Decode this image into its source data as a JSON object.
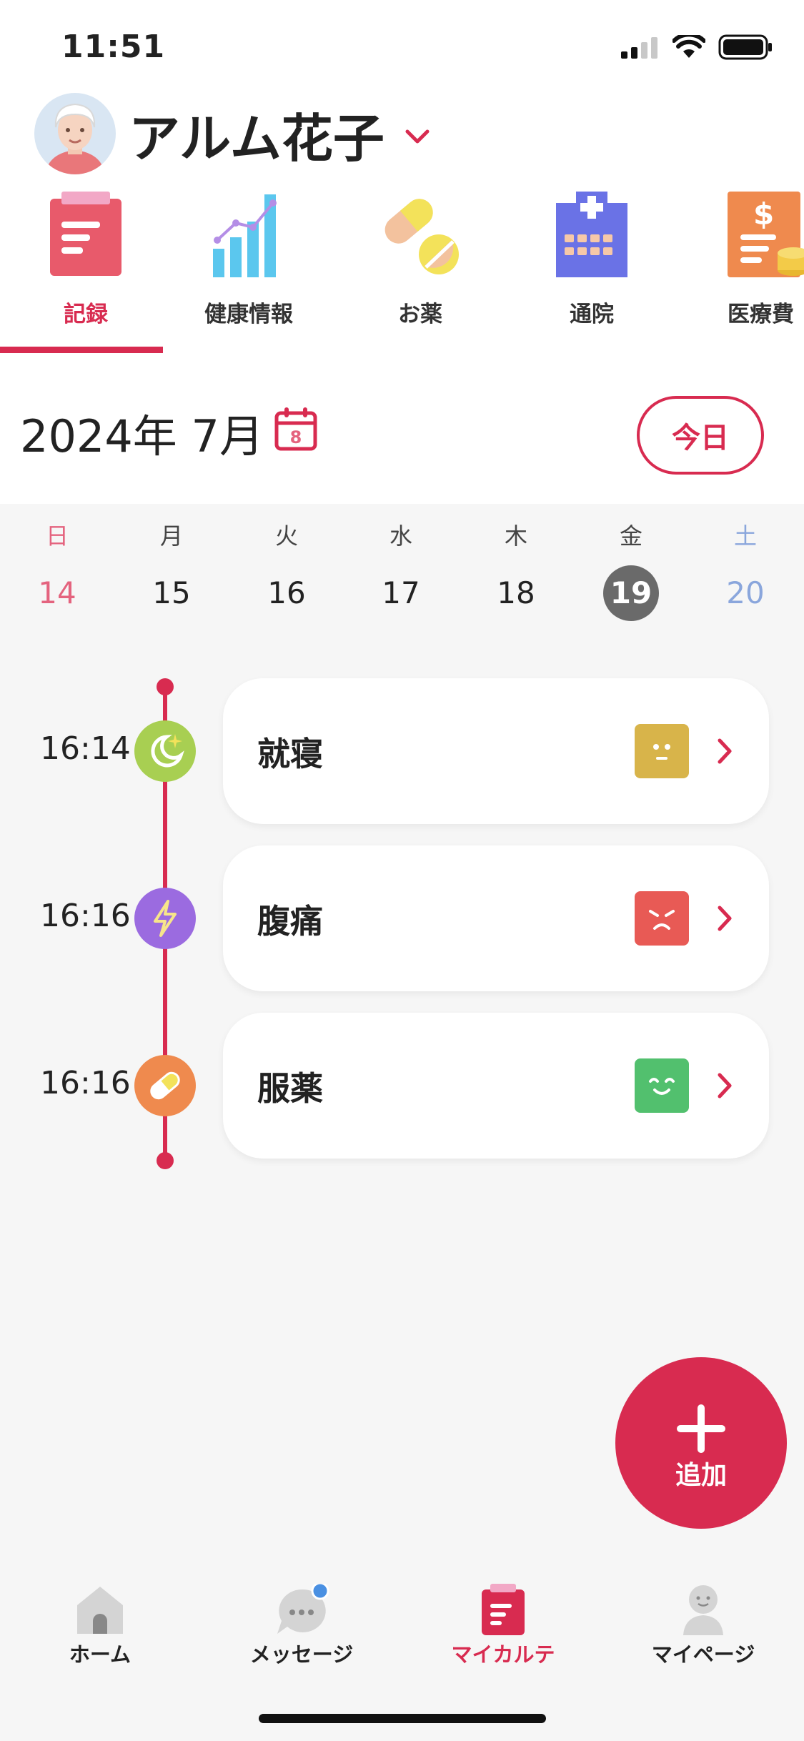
{
  "status": {
    "time": "11:51"
  },
  "user": {
    "name": "アルム花子"
  },
  "categories": [
    {
      "label": "記録",
      "icon": "record-icon",
      "active": true
    },
    {
      "label": "健康情報",
      "icon": "chart-icon"
    },
    {
      "label": "お薬",
      "icon": "pill-icon"
    },
    {
      "label": "通院",
      "icon": "hospital-icon"
    },
    {
      "label": "医療費",
      "icon": "medical-cost-icon"
    }
  ],
  "calendar": {
    "month_label": "2024年 7月",
    "cal_icon_day": "8",
    "today_label": "今日",
    "weekdays": [
      "日",
      "月",
      "火",
      "水",
      "木",
      "金",
      "土"
    ],
    "dates": [
      "14",
      "15",
      "16",
      "17",
      "18",
      "19",
      "20"
    ],
    "selected_index": 5
  },
  "records": [
    {
      "time": "16:14",
      "title": "就寝",
      "icon": "sleep-moon-icon",
      "icon_color": "#a8cf52",
      "mood": "neutral",
      "mood_color": "#d8b44a"
    },
    {
      "time": "16:16",
      "title": "腹痛",
      "icon": "lightning-icon",
      "icon_color": "#9b6be0",
      "mood": "sad",
      "mood_color": "#e85a55"
    },
    {
      "time": "16:16",
      "title": "服薬",
      "icon": "pill-icon",
      "icon_color": "#ef8a4e",
      "mood": "happy",
      "mood_color": "#52c06e"
    }
  ],
  "fab": {
    "label": "追加"
  },
  "tabs": [
    {
      "label": "ホーム",
      "icon": "home-icon"
    },
    {
      "label": "メッセージ",
      "icon": "message-icon",
      "badge": true
    },
    {
      "label": "マイカルテ",
      "icon": "chart-record-icon",
      "active": true
    },
    {
      "label": "マイページ",
      "icon": "person-icon"
    }
  ],
  "colors": {
    "accent": "#d82b50",
    "selected_day": "#6a6a6a",
    "sunday": "#e4637e",
    "saturday": "#8aa6dc",
    "badge": "#4a90e2"
  }
}
